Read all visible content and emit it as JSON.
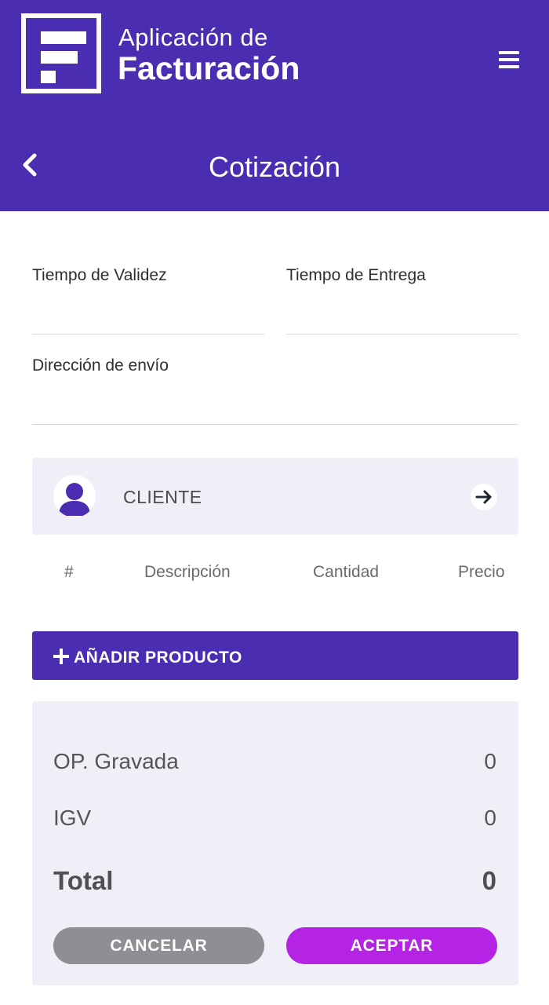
{
  "header": {
    "app_subtitle": "Aplicación de",
    "app_title": "Facturación",
    "page_title": "Cotización",
    "brand_color": "#4a2db0"
  },
  "form": {
    "validity_label": "Tiempo de Validez",
    "validity_value": "",
    "delivery_label": "Tiempo de Entrega",
    "delivery_value": "",
    "address_label": "Dirección de envío",
    "address_value": ""
  },
  "client": {
    "label": "CLIENTE",
    "icon": "user-icon",
    "action_icon": "arrow-right-icon"
  },
  "table": {
    "headers": [
      "#",
      "Descripción",
      "Cantidad",
      "Precio"
    ]
  },
  "add_product": {
    "label": "AÑADIR PRODUCTO",
    "icon": "plus-icon"
  },
  "totals": {
    "gravada_label": "OP. Gravada",
    "gravada_value": "0",
    "igv_label": "IGV",
    "igv_value": "0",
    "total_label": "Total",
    "total_value": "0"
  },
  "actions": {
    "cancel_label": "CANCELAR",
    "cancel_color": "#8e8e93",
    "accept_label": "ACEPTAR",
    "accept_color": "#b524e4"
  }
}
